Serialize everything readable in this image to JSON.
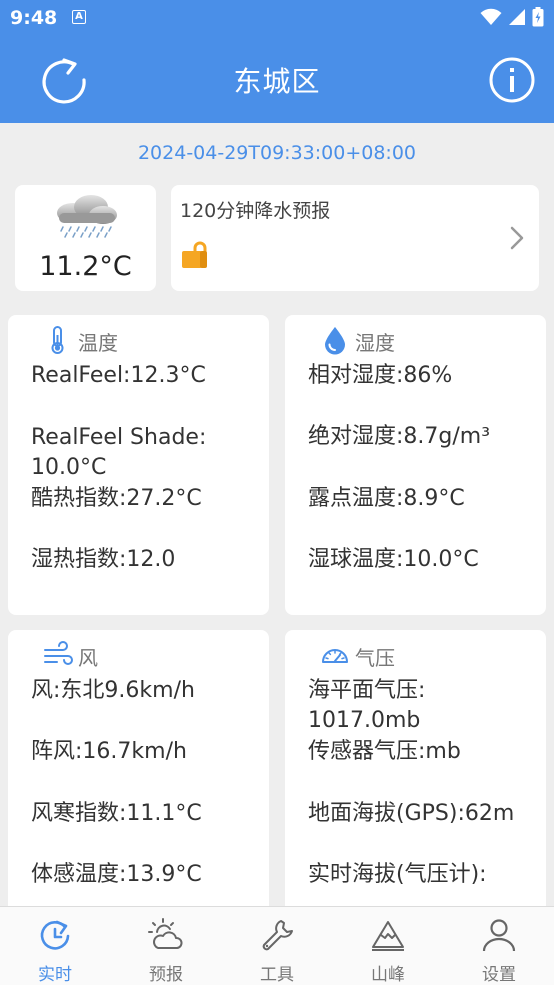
{
  "status": {
    "time": "9:48",
    "app_icon": "A"
  },
  "header": {
    "title": "东城区"
  },
  "timestamp": "2024-04-29T09:33:00+08:00",
  "current": {
    "temperature": "11.2°C",
    "icon": "cloud-rain-icon"
  },
  "precip": {
    "title": "120分钟降水预报"
  },
  "temperature_card": {
    "title": "温度",
    "lines": [
      "RealFeel:12.3°C",
      "RealFeel Shade:",
      "10.0°C",
      "酷热指数:27.2°C",
      "湿热指数:12.0"
    ]
  },
  "humidity_card": {
    "title": "湿度",
    "lines": [
      "相对湿度:86%",
      "绝对湿度:8.7g/m³",
      "露点温度:8.9°C",
      "湿球温度:10.0°C"
    ]
  },
  "wind_card": {
    "title": "风",
    "lines": [
      "风:东北9.6km/h",
      "阵风:16.7km/h",
      "风寒指数:11.1°C",
      "体感温度:13.9°C"
    ]
  },
  "pressure_card": {
    "title": "气压",
    "lines": [
      "海平面气压:",
      "1017.0mb",
      "传感器气压:mb",
      "地面海拔(GPS):62m",
      "实时海拔(气压计):"
    ]
  },
  "nav": {
    "items": [
      {
        "label": "实时",
        "icon": "realtime-icon",
        "active": true
      },
      {
        "label": "预报",
        "icon": "forecast-icon"
      },
      {
        "label": "工具",
        "icon": "wrench-icon"
      },
      {
        "label": "山峰",
        "icon": "mountain-icon"
      },
      {
        "label": "设置",
        "icon": "person-icon"
      }
    ]
  },
  "colors": {
    "primary": "#4a8fe8",
    "background": "#eeeeee",
    "card": "#ffffff",
    "lock": "#f5a623"
  }
}
